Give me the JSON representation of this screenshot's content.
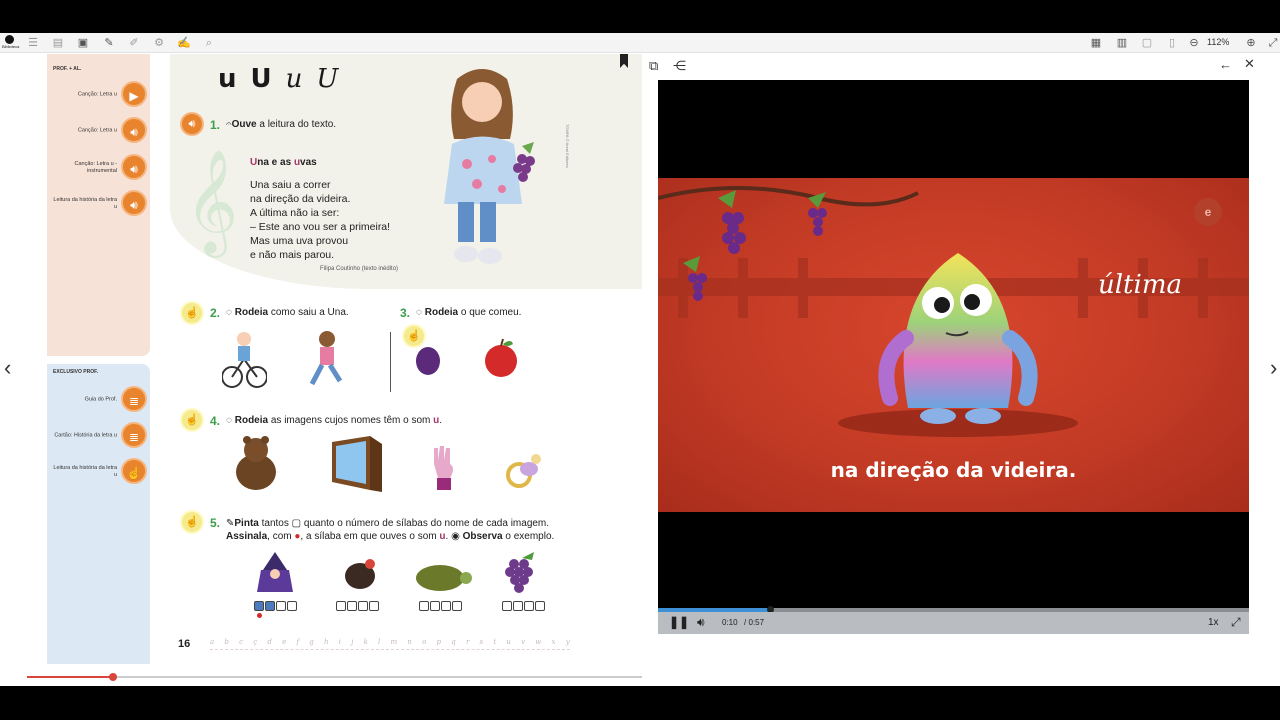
{
  "toolbar": {
    "logo_text": "Biblioteca",
    "zoom": "112%"
  },
  "prof_panel": {
    "title": "PROF. + AL.",
    "items": [
      {
        "label": "Canção: Letra u",
        "icon": "play-icon"
      },
      {
        "label": "Canção: Letra u",
        "icon": "speaker-icon"
      },
      {
        "label": "Canção: Letra u - instrumental",
        "icon": "speaker-icon"
      },
      {
        "label": "Leitura da história da letra u",
        "icon": "speaker-icon"
      }
    ]
  },
  "excl_panel": {
    "title": "EXCLUSIVO PROF.",
    "items": [
      {
        "label": "Guia do Prof.",
        "icon": "document-icon"
      },
      {
        "label": "Cartão: História da letra u",
        "icon": "document-icon"
      },
      {
        "label": "Leitura da história da letra u",
        "icon": "touch-icon"
      }
    ]
  },
  "lesson": {
    "letters": [
      "u",
      "U",
      "u",
      "U"
    ],
    "q1": {
      "num": "1.",
      "bold": "Ouve",
      "rest": " a leitura do texto."
    },
    "poem": {
      "title_hl1": "U",
      "title_mid1": "na e as ",
      "title_hl2": "u",
      "title_mid2": "vas",
      "lines": [
        "Una saiu a correr",
        "na direção da videira.",
        "A última não ia ser:",
        "– Este ano vou ser a primeira!",
        "Mas uma uva provou",
        "e não mais parou."
      ],
      "author": "Filipa Coutinho (texto inédito)"
    },
    "credit": "TOMPA © Areal Editores",
    "q2": {
      "num": "2.",
      "bold": "Rodeia",
      "rest": " como saiu a Una."
    },
    "q3": {
      "num": "3.",
      "bold": "Rodeia",
      "rest": " o que comeu."
    },
    "q4": {
      "num": "4.",
      "bold": "Rodeia",
      "rest": " as imagens cujos nomes têm o som ",
      "hl": "u",
      "end": "."
    },
    "q5": {
      "num": "5.",
      "bold1": "Pinta",
      "rest1": " tantos ",
      "rest1b": " quanto o número de sílabas do nome de cada imagem.",
      "bold2": "Assinala",
      "rest2": ", com ",
      "rest2b": ", a sílaba em que ouves o som ",
      "hl": "u",
      "rest2c": ". ",
      "bold3": "Observa",
      "rest3": " o exemplo."
    },
    "page_number": "16",
    "alphabet": "a b c ç d e f g h i j k l m n o p q r s t u v w x y z"
  },
  "progress": {
    "fraction": 0.14
  },
  "viewer": {
    "video_word": "última",
    "caption": "na direção da videira.",
    "current_time": "0:10",
    "duration": "/ 0:57",
    "speed": "1x",
    "progress_fraction": 0.19,
    "logo": "e"
  }
}
